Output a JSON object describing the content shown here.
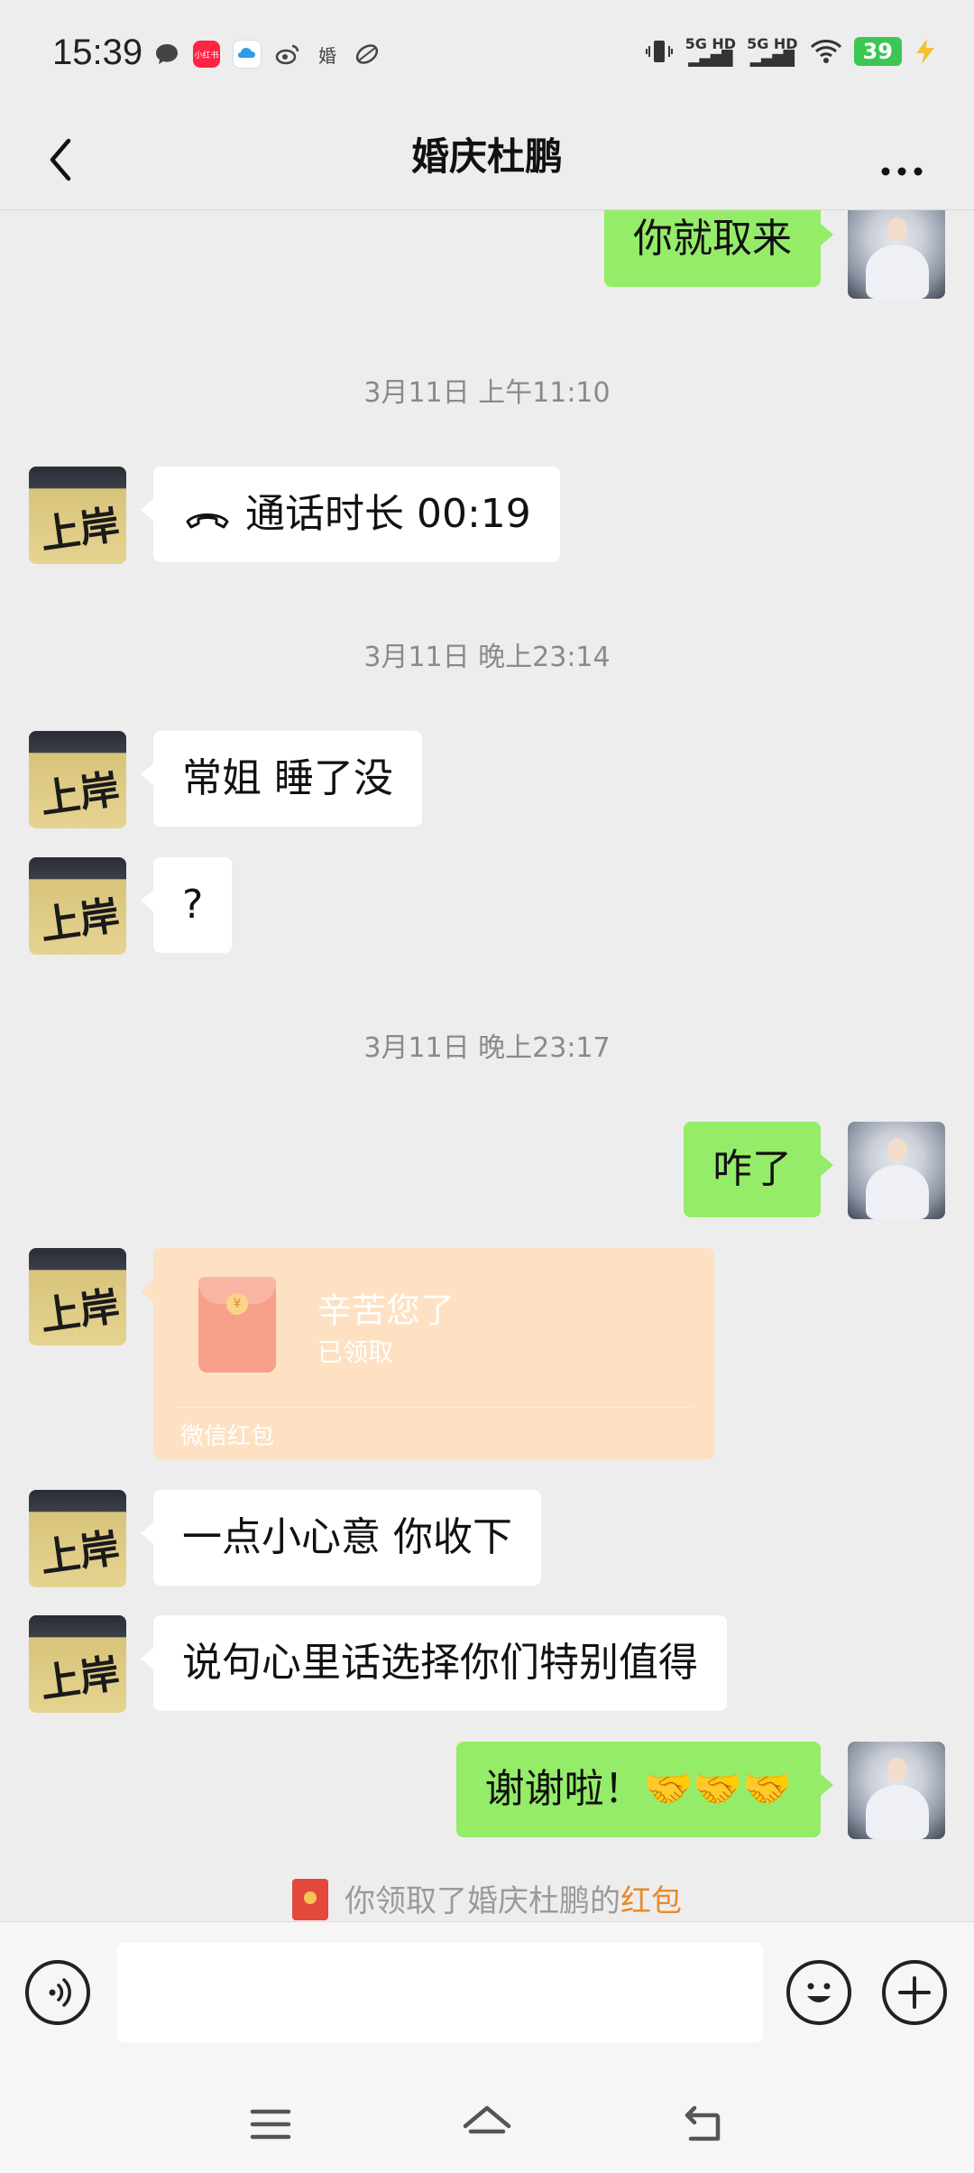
{
  "status_bar": {
    "time": "15:39",
    "signal_1": "5G HD",
    "signal_2": "5G HD",
    "battery": "39",
    "icons": [
      "message-icon",
      "xiaohongshu-icon",
      "cloud-app-icon",
      "weibo-icon",
      "hun-app-icon",
      "leaf-app-icon",
      "vibrate-icon",
      "wifi-icon",
      "charging-icon"
    ],
    "xiaohongshu_label": "小红书",
    "hun_label": "婚"
  },
  "header": {
    "title": "婚庆杜鹏"
  },
  "messages": {
    "m1": "你就取来",
    "ts1": "3月11日 上午11:10",
    "call": "通话时长 00:19",
    "ts2": "3月11日 晚上23:14",
    "m2": "常姐 睡了没",
    "m3": "?",
    "ts3": "3月11日 晚上23:17",
    "m4": "咋了",
    "red_packet": {
      "title": "辛苦您了",
      "status": "已领取",
      "footer": "微信红包"
    },
    "m5": "一点小心意 你收下",
    "m6": "说句心里话选择你们特别值得",
    "m7": "谢谢啦！🤝🤝🤝",
    "system_note": {
      "text": "你领取了婚庆杜鹏的",
      "link": "红包"
    }
  },
  "avatars": {
    "other_label": "上岸"
  },
  "colors": {
    "my_bubble": "#95ec69",
    "other_bubble": "#ffffff",
    "red_packet": "#fde1c2",
    "background": "#ededed",
    "link": "#e8892b"
  }
}
